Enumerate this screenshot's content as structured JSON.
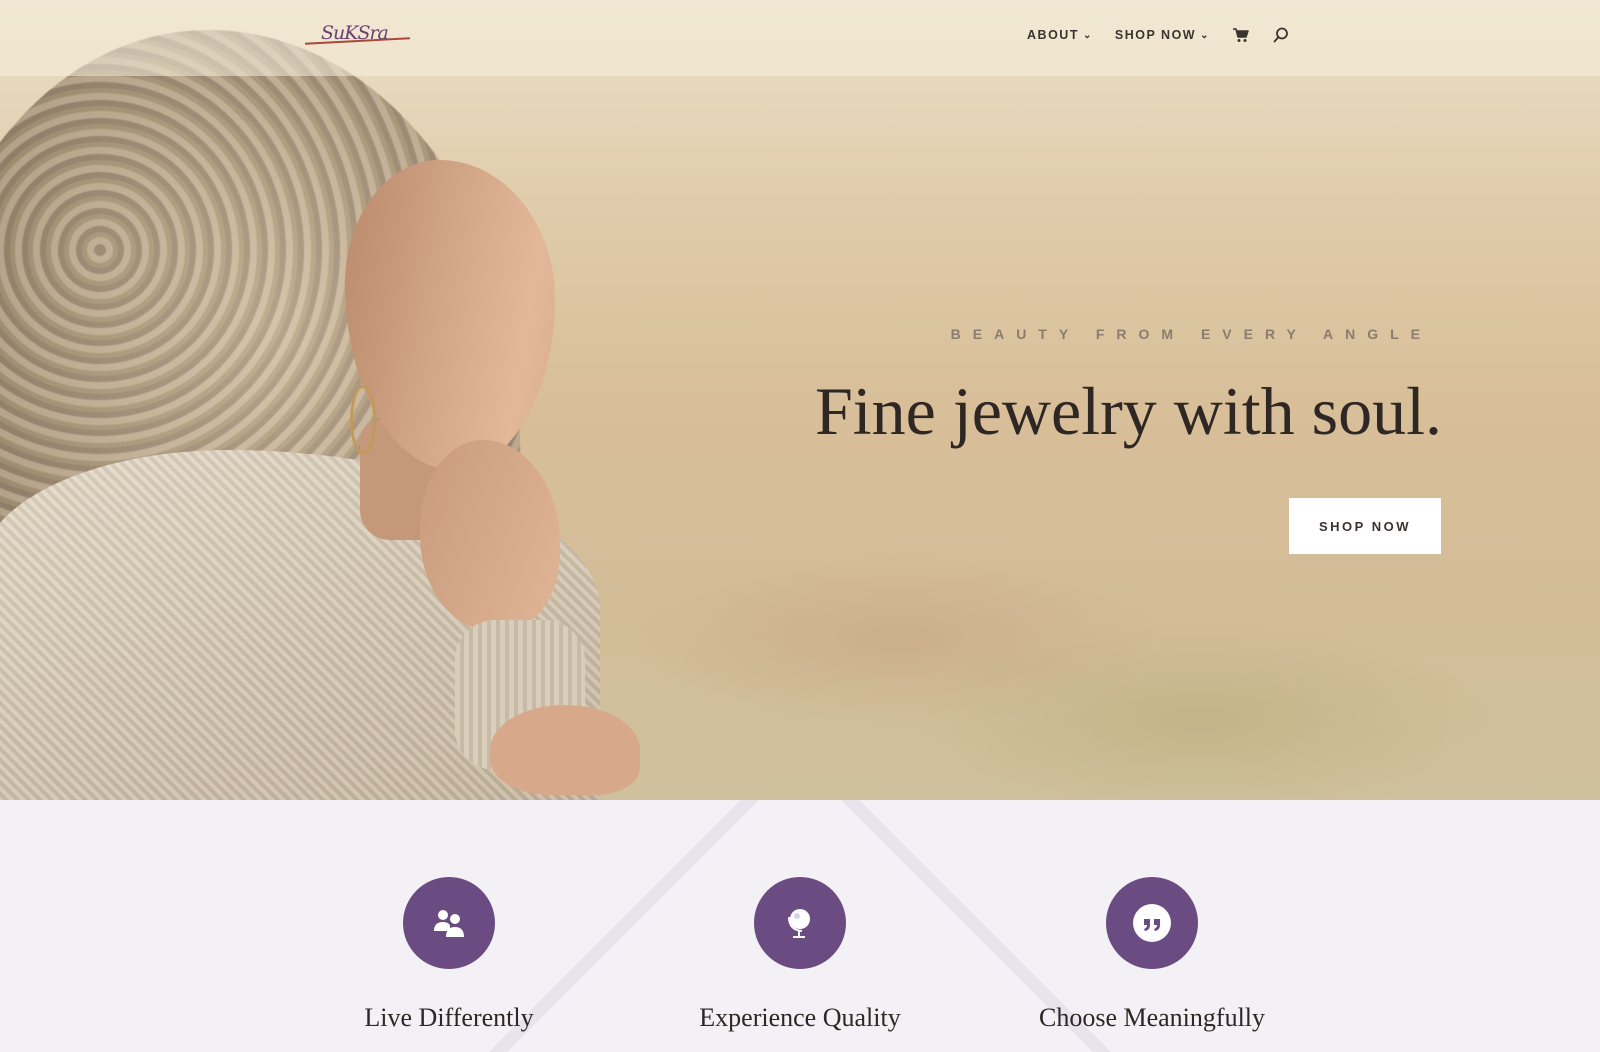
{
  "header": {
    "logo_text": "SuKSra",
    "nav": {
      "about_label": "ABOUT",
      "shop_label": "SHOP NOW",
      "cart_icon": "cart-icon",
      "search_icon": "search-icon"
    }
  },
  "hero": {
    "eyebrow": "BEAUTY FROM EVERY ANGLE",
    "headline": "Fine jewelry with soul.",
    "cta_label": "SHOP NOW"
  },
  "features": {
    "items": [
      {
        "title": "Live Differently",
        "icon": "people-icon"
      },
      {
        "title": "Experience Quality",
        "icon": "globe-icon"
      },
      {
        "title": "Choose Meaningfully",
        "icon": "quote-icon"
      }
    ]
  },
  "colors": {
    "accent": "#6a4b82",
    "text_dark": "#2f2723",
    "hero_bg": "#d8bf99"
  }
}
